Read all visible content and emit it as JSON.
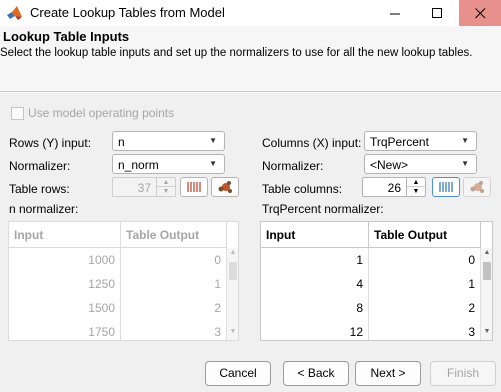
{
  "window": {
    "title": "Create Lookup Tables from Model",
    "app_icon": "matlab-logo-icon",
    "controls": {
      "minimize": "—",
      "maximize": "☐",
      "close": "✕"
    }
  },
  "header": {
    "title": "Lookup Table Inputs",
    "description": "Select the lookup table inputs and set up the normalizers to use for all the new lookup tables."
  },
  "options": {
    "use_operating_points_label": "Use model operating points",
    "use_operating_points_checked": false
  },
  "rows": {
    "input_label": "Rows (Y) input:",
    "input_value": "n",
    "normalizer_label": "Normalizer:",
    "normalizer_value": "n_norm",
    "count_label": "Table rows:",
    "count_value": "37",
    "normalizer_table_label": "n normalizer:",
    "table": {
      "columns": [
        "Input",
        "Table Output"
      ],
      "rows": [
        [
          "1000",
          "0"
        ],
        [
          "1250",
          "1"
        ],
        [
          "1500",
          "2"
        ],
        [
          "1750",
          "3"
        ]
      ]
    }
  },
  "columns": {
    "input_label": "Columns (X) input:",
    "input_value": "TrqPercent",
    "normalizer_label": "Normalizer:",
    "normalizer_value": "<New>",
    "count_label": "Table columns:",
    "count_value": "26",
    "normalizer_table_label": "TrqPercent normalizer:",
    "table": {
      "columns": [
        "Input",
        "Table Output"
      ],
      "rows": [
        [
          "1",
          "0"
        ],
        [
          "4",
          "1"
        ],
        [
          "8",
          "2"
        ],
        [
          "12",
          "3"
        ]
      ]
    }
  },
  "footer": {
    "cancel": "Cancel",
    "back": "< Back",
    "next": "Next >",
    "finish": "Finish"
  },
  "glyphs": {
    "dropdown_arrow": "▼",
    "spin_up": "▲",
    "spin_down": "▼"
  },
  "colors": {
    "close_button_bg": "#e8908c",
    "focus_blue": "#4a90d9",
    "disabled_text": "#a6a6a6"
  }
}
